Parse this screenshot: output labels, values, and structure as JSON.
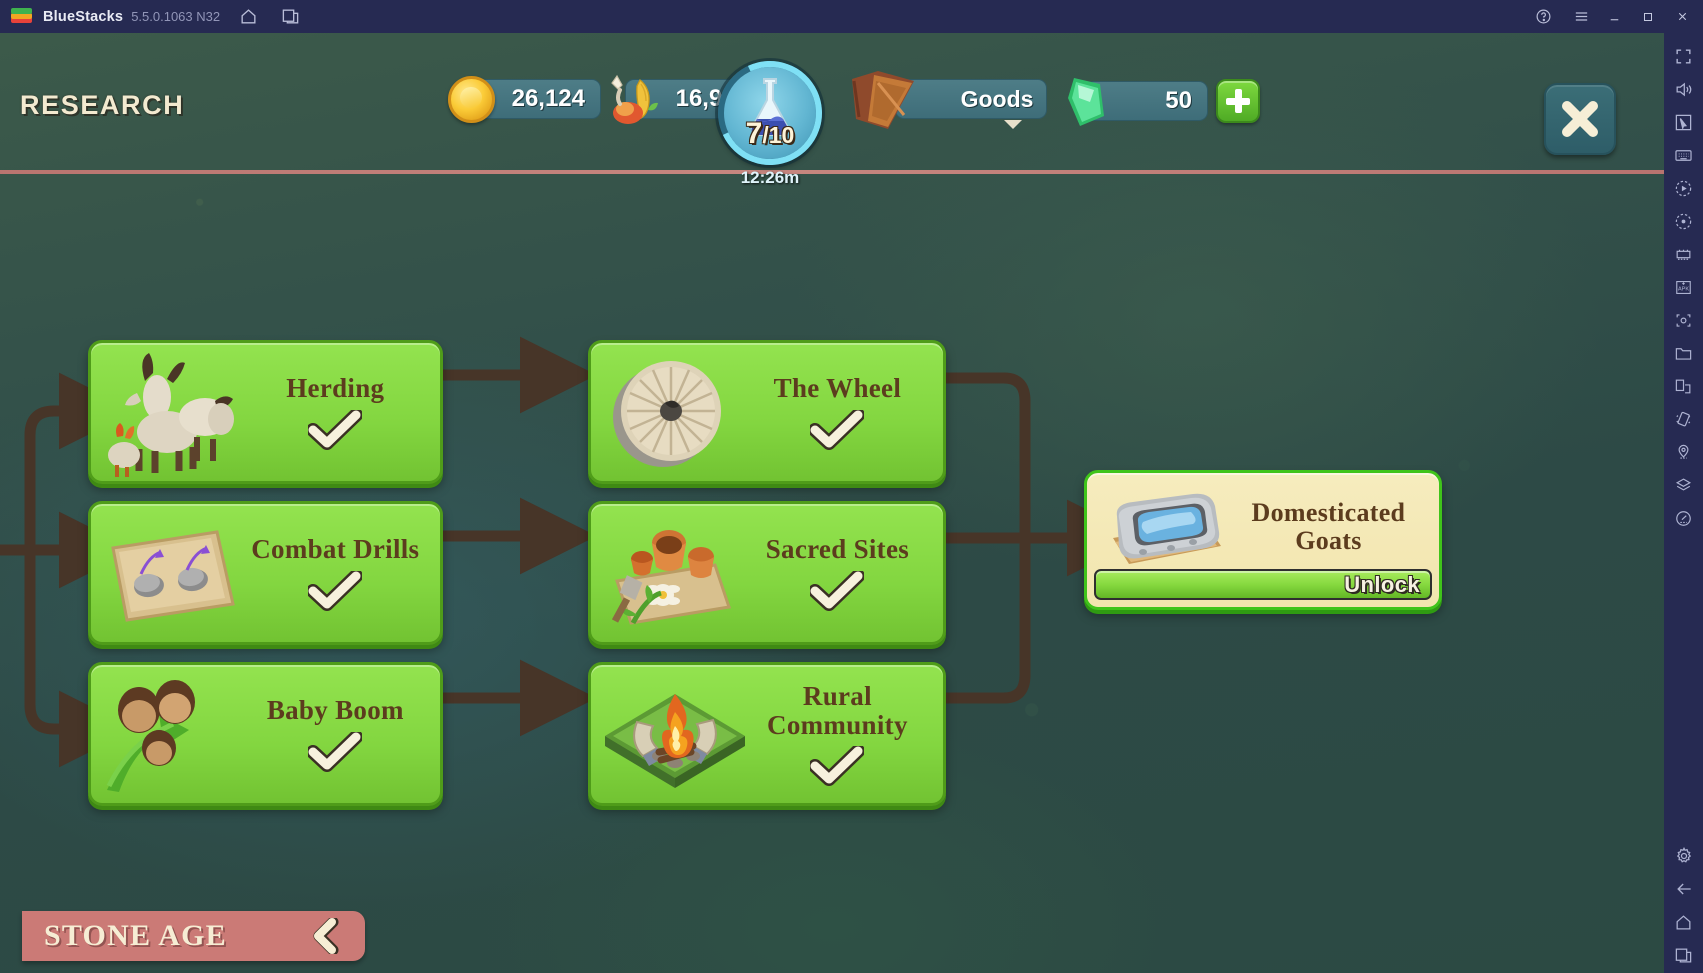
{
  "titlebar": {
    "app_name": "BlueStacks",
    "version": "5.5.0.1063 N32",
    "icons": [
      "home-icon",
      "multi-instance-icon"
    ],
    "right_icons": [
      "help-icon",
      "menu-icon"
    ],
    "window_buttons": [
      "minimize",
      "maximize",
      "close"
    ]
  },
  "rail": {
    "icons": [
      "fullscreen-icon",
      "volume-icon",
      "cursor-icon",
      "keyboard-icon",
      "macro-record-icon",
      "macro-play-icon",
      "multi-instance-manager-icon",
      "install-apk-icon",
      "screenshot-icon",
      "media-folder-icon",
      "rotate-screen-icon",
      "shake-icon",
      "location-icon",
      "layers-icon",
      "gyroscope-icon",
      "settings-icon",
      "back-icon",
      "home-icon",
      "recents-icon"
    ]
  },
  "header": {
    "title": "RESEARCH",
    "close_label": "close-icon"
  },
  "resources": [
    {
      "name": "coins",
      "icon": "coin-icon",
      "value": "26,124"
    },
    {
      "name": "food",
      "icon": "food-icon",
      "value": "16,948"
    },
    {
      "name": "goods",
      "icon": "crate-icon",
      "value": "Goods"
    },
    {
      "name": "gems",
      "icon": "gem-icon",
      "value": "50"
    }
  ],
  "research_points": {
    "icon": "flask-icon",
    "current": "7",
    "separator": "/",
    "max": "10",
    "timer": "12:26m"
  },
  "add_button_label": "+",
  "tree": {
    "cards": [
      {
        "name": "Herding",
        "art": "goats-art",
        "state": "completed",
        "check": "✓"
      },
      {
        "name": "The Wheel",
        "art": "wheel-art",
        "state": "completed",
        "check": "✓"
      },
      {
        "name": "Combat Drills",
        "art": "tablet-art",
        "state": "completed",
        "check": "✓"
      },
      {
        "name": "Sacred Sites",
        "art": "offering-art",
        "state": "completed",
        "check": "✓"
      },
      {
        "name": "Baby Boom",
        "art": "people-art",
        "state": "completed",
        "check": "✓"
      },
      {
        "name": "Rural Community",
        "art": "campfire-art",
        "state": "completed",
        "check": "✓"
      },
      {
        "name": "Domesticated Goats",
        "art": "trough-art",
        "state": "unlockable",
        "unlock_label": "Unlock"
      }
    ]
  },
  "age_banner": {
    "label": "STONE AGE",
    "prev_icon": "chevron-left-icon"
  },
  "colors": {
    "card_green": "#83d640",
    "card_green_border": "#4f9c19",
    "locked_card_bg": "#f2e5ae",
    "unlock_green": "#86d93f",
    "banner_rose": "#cb7a76",
    "connector_brown": "#473528",
    "title_cream": "#f3ead0",
    "rail_navy": "#262a52"
  }
}
